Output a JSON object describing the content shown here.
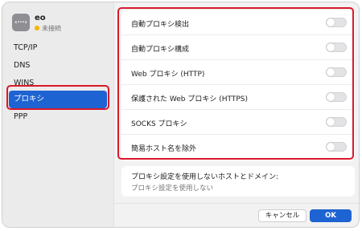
{
  "interface": {
    "icon_glyph": "‹···›",
    "name": "eo",
    "status": "未接続",
    "status_color": "#f5b400"
  },
  "sidebar": {
    "items": [
      {
        "label": "TCP/IP"
      },
      {
        "label": "DNS"
      },
      {
        "label": "WINS"
      },
      {
        "label": "プロキシ",
        "selected": true
      },
      {
        "label": "PPP"
      }
    ]
  },
  "proxies": {
    "rows": [
      {
        "label": "自動プロキシ検出",
        "enabled": false
      },
      {
        "label": "自動プロキシ構成",
        "enabled": false
      },
      {
        "label": "Web プロキシ (HTTP)",
        "enabled": false
      },
      {
        "label": "保護された Web プロキシ (HTTPS)",
        "enabled": false
      },
      {
        "label": "SOCKS プロキシ",
        "enabled": false
      },
      {
        "label": "簡易ホスト名を除外",
        "enabled": false
      }
    ]
  },
  "bypass": {
    "title": "プロキシ設定を使用しないホストとドメイン:",
    "placeholder": "プロキシ設定を使用しない"
  },
  "buttons": {
    "cancel": "キャンセル",
    "ok": "OK"
  },
  "colors": {
    "accent": "#1e63d2",
    "highlight_outline": "#d9192a"
  }
}
